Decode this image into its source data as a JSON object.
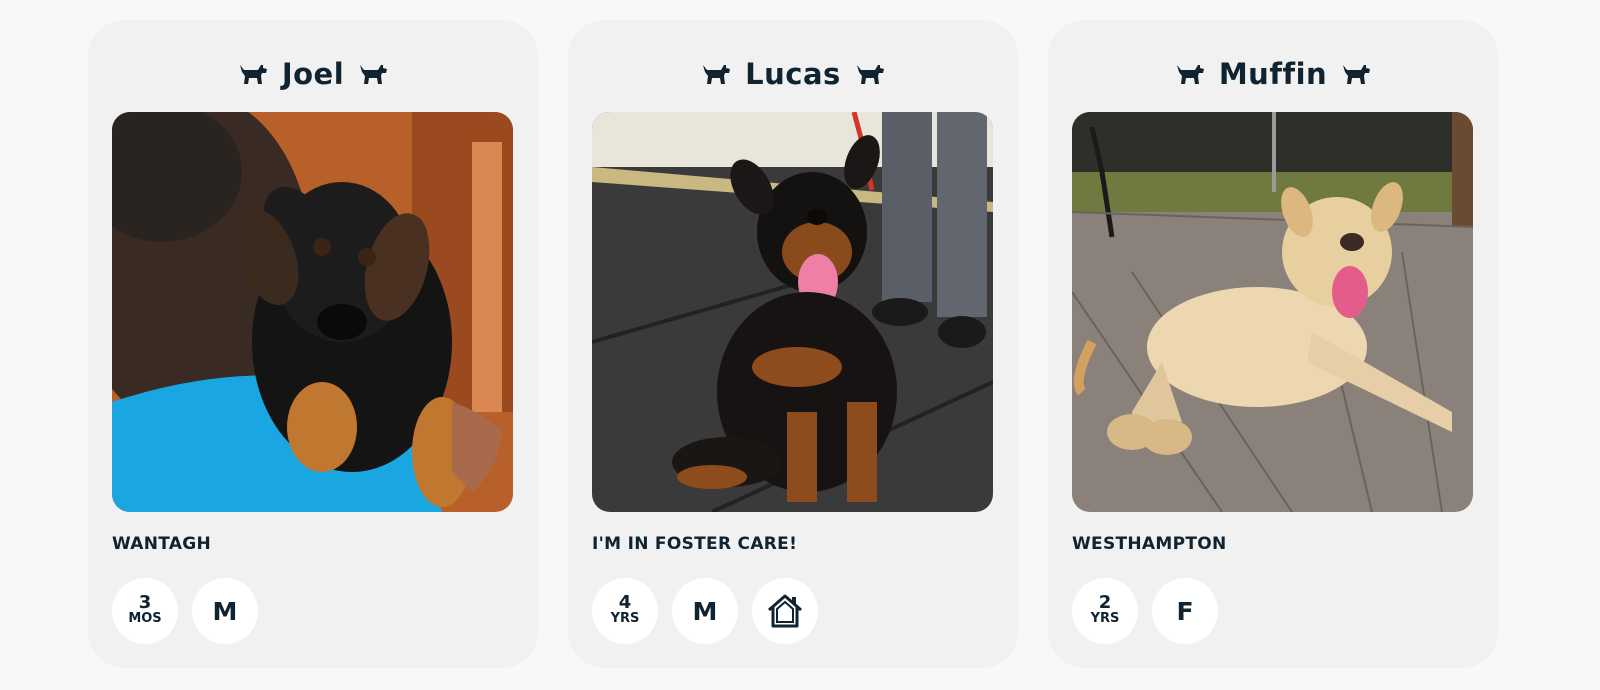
{
  "cards": [
    {
      "name": "Joel",
      "photo_icon": "puppy-on-shoulder-photo",
      "location": "WANTAGH",
      "age_value": "3",
      "age_unit": "MOS",
      "sex": "M",
      "foster": false
    },
    {
      "name": "Lucas",
      "photo_icon": "rottweiler-sitting-photo",
      "location": "I'M IN FOSTER CARE!",
      "age_value": "4",
      "age_unit": "YRS",
      "sex": "M",
      "foster": true,
      "foster_icon": "home-icon"
    },
    {
      "name": "Muffin",
      "photo_icon": "yellow-dog-lying-photo",
      "location": "WESTHAMPTON",
      "age_value": "2",
      "age_unit": "YRS",
      "sex": "F",
      "foster": false
    }
  ],
  "colors": {
    "text": "#0f2330",
    "card_bg": "#f1f1f1",
    "badge_bg": "#ffffff",
    "page_bg": "#f8f8f8"
  }
}
